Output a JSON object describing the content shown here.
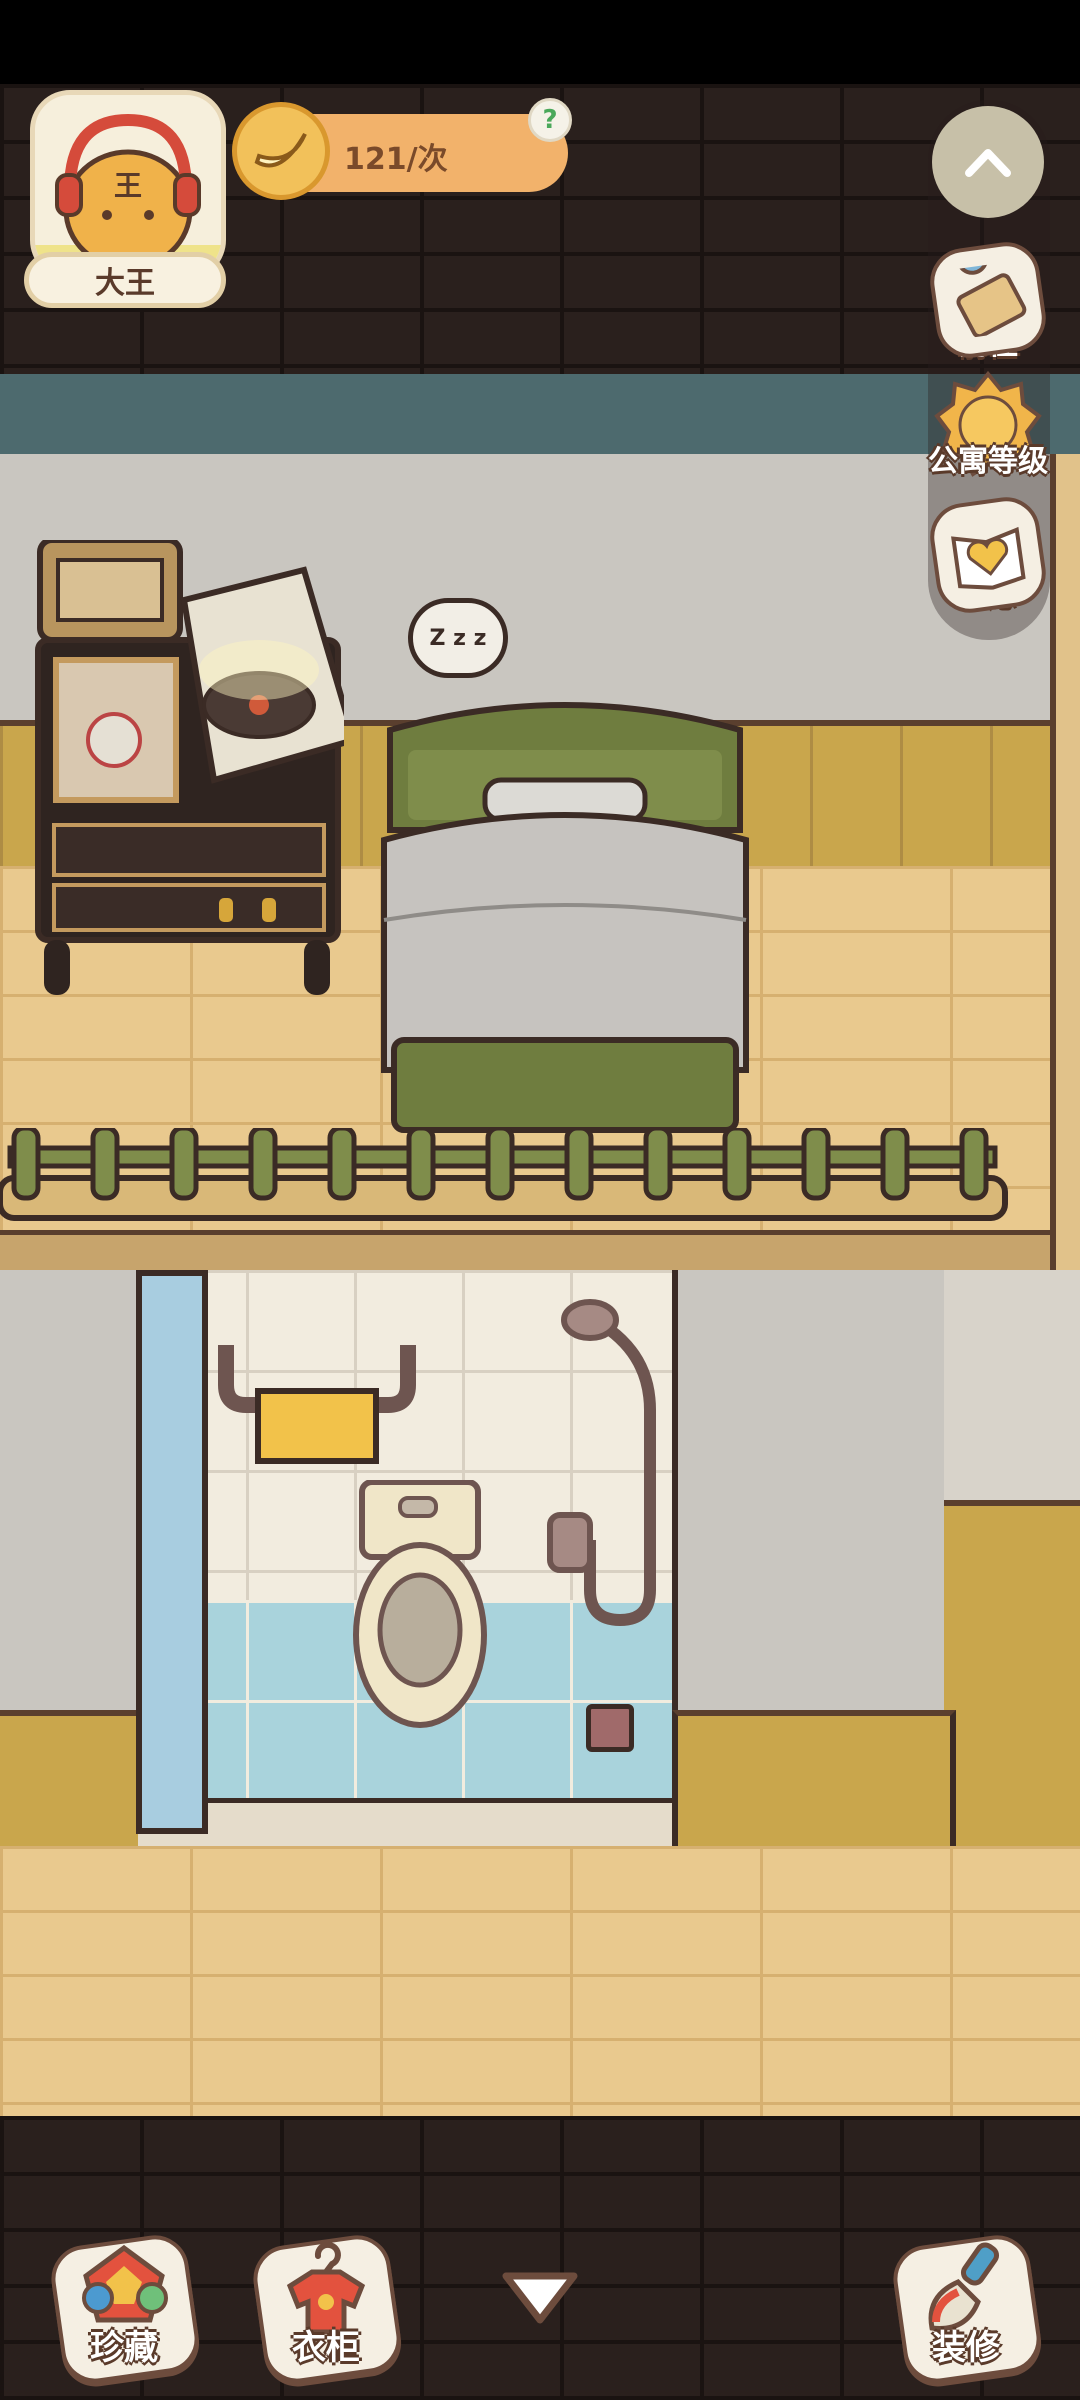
{
  "player": {
    "name": "大王",
    "avatar_icon": "tiger-with-headphones-icon"
  },
  "energy": {
    "value_text": "121/次",
    "icon": "banana-icon",
    "help": "?"
  },
  "side_menu": {
    "collapse_icon": "chevron-up-icon",
    "items": [
      {
        "label": "前往",
        "icon": "map-pin-icon"
      },
      {
        "label": "公寓等级",
        "icon": "cat-badge-icon"
      },
      {
        "label": "心愿",
        "icon": "heart-book-icon"
      }
    ]
  },
  "scene": {
    "sleep_bubble": "Z z z"
  },
  "bottom_bar": {
    "items": [
      {
        "label": "珍藏",
        "icon": "treasure-gem-icon"
      },
      {
        "label": "衣柜",
        "icon": "clothes-hanger-icon"
      },
      {
        "label": "装修",
        "icon": "paint-brush-icon"
      }
    ],
    "expand_icon": "triangle-down-icon"
  },
  "colors": {
    "wall_dark": "#2a201d",
    "wall_grey": "#c9c6c0",
    "accent_orange": "#f2b26b",
    "bed_green": "#6f7d3f",
    "floor_wood": "#e9c98e"
  }
}
